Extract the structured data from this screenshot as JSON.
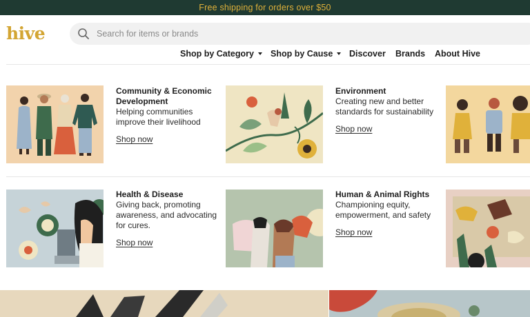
{
  "promo": {
    "text": "Free shipping for orders over $50"
  },
  "logo": {
    "text": "hive"
  },
  "search": {
    "placeholder": "Search for items or brands"
  },
  "nav": [
    {
      "label": "Shop by Category",
      "dropdown": true
    },
    {
      "label": "Shop by Cause",
      "dropdown": true
    },
    {
      "label": "Discover",
      "dropdown": false
    },
    {
      "label": "Brands",
      "dropdown": false
    },
    {
      "label": "About Hive",
      "dropdown": false
    }
  ],
  "causes": [
    {
      "title": "Community & Economic Development",
      "description": "Helping communities improve their livelihood",
      "link": "Shop now"
    },
    {
      "title": "Environment",
      "description": "Creating new and better standards for sustainability",
      "link": "Shop now"
    },
    {
      "title": "Health & Disease",
      "description": "Giving back, promoting awareness, and advocating for cures.",
      "link": "Shop now"
    },
    {
      "title": "Human & Animal Rights",
      "description": "Championing equity, empowerment, and safety",
      "link": "Shop now"
    }
  ],
  "colors": {
    "promo_bg": "#1f3a32",
    "promo_text": "#e0b13a",
    "logo": "#d3a533",
    "card_bg_peach": "#f2d3ac",
    "card_bg_sage": "#b5c4ad",
    "card_bg_blue": "#c6d3d8",
    "card_bg_tan": "#e8d8bc"
  }
}
